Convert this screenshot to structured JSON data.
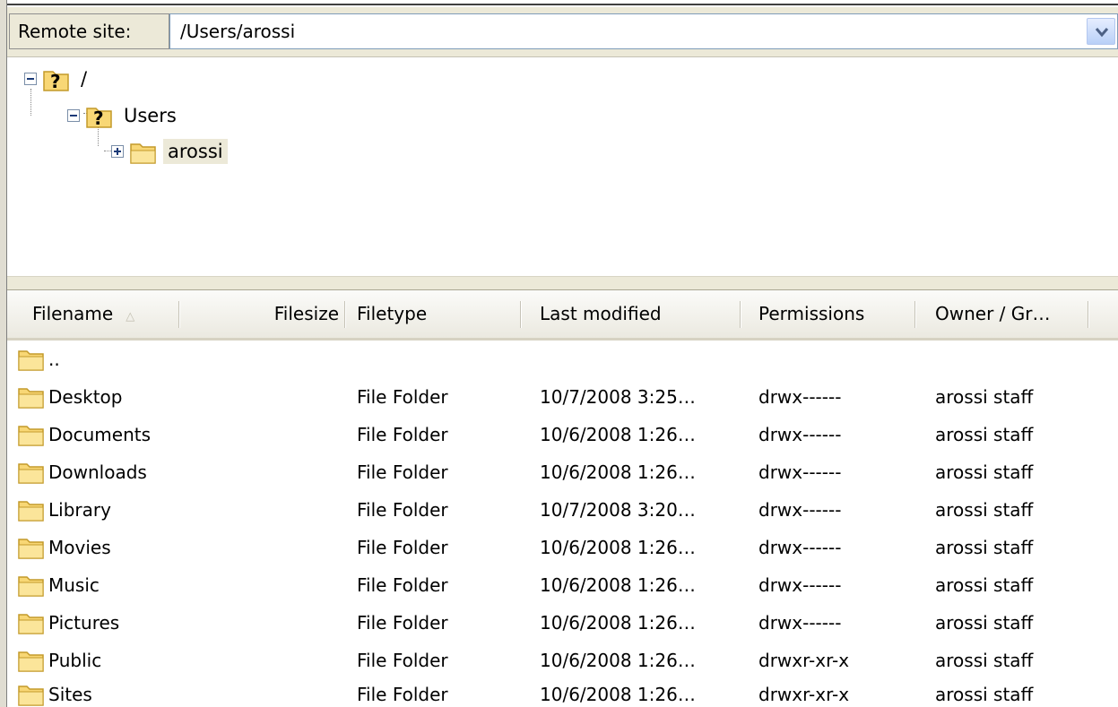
{
  "remote_site": {
    "label": "Remote site:",
    "path": "/Users/arossi"
  },
  "tree": {
    "nodes": [
      {
        "label": "/",
        "state": "expanded",
        "icon": "unknown-folder-icon"
      },
      {
        "label": "Users",
        "state": "expanded",
        "icon": "unknown-folder-icon"
      },
      {
        "label": "arossi",
        "state": "collapsed",
        "icon": "folder-icon",
        "selected": true
      }
    ]
  },
  "columns": {
    "filename": "Filename",
    "sort_indicator": "△",
    "filesize": "Filesize",
    "filetype": "Filetype",
    "last_modified": "Last modified",
    "permissions": "Permissions",
    "owner_group": "Owner / Gr…"
  },
  "files": [
    {
      "name": "..",
      "size": "",
      "type": "",
      "modified": "",
      "perms": "",
      "owner": ""
    },
    {
      "name": "Desktop",
      "size": "",
      "type": "File Folder",
      "modified": "10/7/2008 3:25…",
      "perms": "drwx------",
      "owner": "arossi staff"
    },
    {
      "name": "Documents",
      "size": "",
      "type": "File Folder",
      "modified": "10/6/2008 1:26…",
      "perms": "drwx------",
      "owner": "arossi staff"
    },
    {
      "name": "Downloads",
      "size": "",
      "type": "File Folder",
      "modified": "10/6/2008 1:26…",
      "perms": "drwx------",
      "owner": "arossi staff"
    },
    {
      "name": "Library",
      "size": "",
      "type": "File Folder",
      "modified": "10/7/2008 3:20…",
      "perms": "drwx------",
      "owner": "arossi staff"
    },
    {
      "name": "Movies",
      "size": "",
      "type": "File Folder",
      "modified": "10/6/2008 1:26…",
      "perms": "drwx------",
      "owner": "arossi staff"
    },
    {
      "name": "Music",
      "size": "",
      "type": "File Folder",
      "modified": "10/6/2008 1:26…",
      "perms": "drwx------",
      "owner": "arossi staff"
    },
    {
      "name": "Pictures",
      "size": "",
      "type": "File Folder",
      "modified": "10/6/2008 1:26…",
      "perms": "drwx------",
      "owner": "arossi staff"
    },
    {
      "name": "Public",
      "size": "",
      "type": "File Folder",
      "modified": "10/6/2008 1:26…",
      "perms": "drwxr-xr-x",
      "owner": "arossi staff"
    },
    {
      "name": "Sites",
      "size": "",
      "type": "File Folder",
      "modified": "10/6/2008 1:26…",
      "perms": "drwxr-xr-x",
      "owner": "arossi staff"
    }
  ],
  "colors": {
    "chrome": "#ece9d8",
    "folder_fill": "#f8d775",
    "folder_stroke": "#c39a2a",
    "combo_border": "#7f9db9"
  }
}
